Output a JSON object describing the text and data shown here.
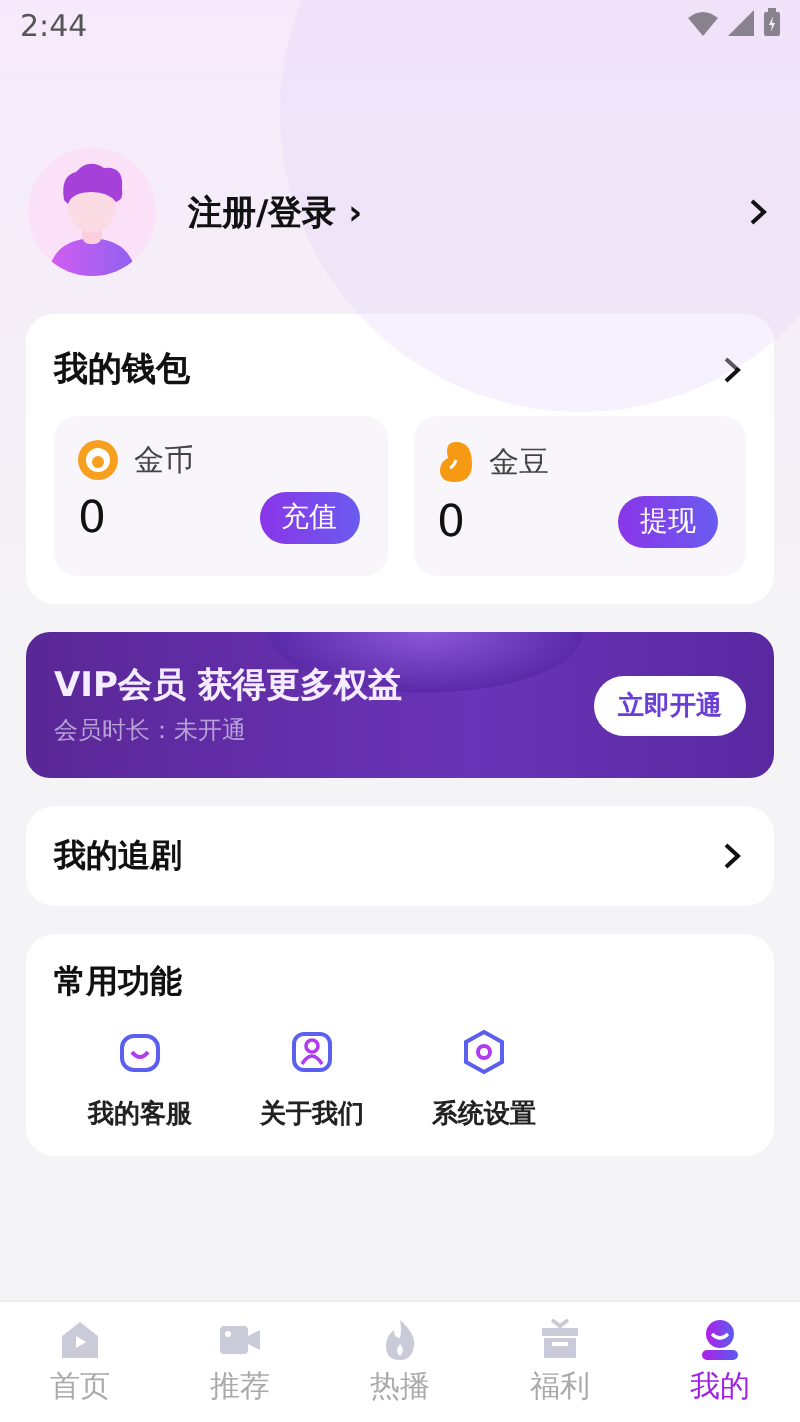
{
  "status_bar": {
    "time": "2:44"
  },
  "profile": {
    "login_label": "注册/登录",
    "login_caret": "›"
  },
  "wallet": {
    "title": "我的钱包",
    "accounts": [
      {
        "kind": "coin",
        "name": "金币",
        "amount": "0",
        "action": "充值"
      },
      {
        "kind": "bean",
        "name": "金豆",
        "amount": "0",
        "action": "提现"
      }
    ]
  },
  "vip_banner": {
    "title": "VIP会员 获得更多权益",
    "subtitle": "会员时长：未开通",
    "button": "立即开通"
  },
  "drama_row": {
    "title": "我的追剧"
  },
  "tools": {
    "title": "常用功能",
    "items": [
      {
        "kind": "service",
        "label": "我的客服"
      },
      {
        "kind": "about",
        "label": "关于我们"
      },
      {
        "kind": "settings",
        "label": "系统设置"
      }
    ]
  },
  "tab_bar": [
    {
      "kind": "home",
      "label": "首页",
      "selected": false
    },
    {
      "kind": "video",
      "label": "推荐",
      "selected": false
    },
    {
      "kind": "hot",
      "label": "热播",
      "selected": false
    },
    {
      "kind": "gift",
      "label": "福利",
      "selected": false
    },
    {
      "kind": "me",
      "label": "我的",
      "selected": true
    }
  ]
}
